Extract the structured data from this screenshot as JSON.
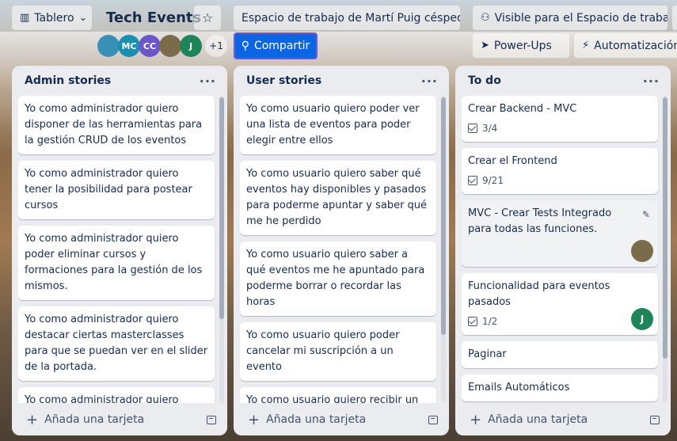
{
  "header": {
    "view_label": "Tablero",
    "board_title": "Tech Events",
    "workspace_label": "Espacio de trabajo de Martí Puig céspedes",
    "visibility_label": "Visible para el Espacio de trabajo",
    "share_label": "Compartir",
    "powerups_label": "Power-Ups",
    "automation_label": "Automatización",
    "extra_members": "+1",
    "members": [
      {
        "initials": "",
        "color": "#3a8fb7"
      },
      {
        "initials": "MC",
        "color": "#1a8fb0"
      },
      {
        "initials": "CC",
        "color": "#6b57c9"
      },
      {
        "initials": "",
        "color": "#7a6b4a"
      },
      {
        "initials": "J",
        "color": "#1f845a"
      }
    ]
  },
  "lists": [
    {
      "title": "Admin stories",
      "add_label": "Añada una tarjeta",
      "cards": [
        {
          "text": "Yo como administrador quiero disponer de las herramientas para la gestión CRUD de los eventos"
        },
        {
          "text": "Yo como administrador quiero tener la posibilidad para postear cursos"
        },
        {
          "text": "Yo como administrador quiero poder eliminar cursos y formaciones para la gestión de los mismos."
        },
        {
          "text": "Yo como administrador quiero destacar ciertas masterclasses para que se puedan ver en el slider de la portada."
        },
        {
          "text": "Yo como administrador quiero tener la posibilidad para la inscripción de alumnos a cursos y establecer un"
        }
      ]
    },
    {
      "title": "User stories",
      "add_label": "Añada una tarjeta",
      "cards": [
        {
          "text": "Yo como usuario quiero poder ver una lista de eventos para poder elegir entre ellos"
        },
        {
          "text": "Yo como usuario quiero saber qué eventos hay disponibles y pasados para poderme apuntar y saber qué me he perdido"
        },
        {
          "text": "Yo como usuario quiero saber a qué eventos me he apuntado para poderme borrar o recordar las horas"
        },
        {
          "text": "Yo como usuario quiero poder cancelar mi suscripción a un evento"
        },
        {
          "text": "Yo como usuario quiero recibir un email recordatorio del evento para que no se me pase la fecha"
        }
      ]
    },
    {
      "title": "To do",
      "add_label": "Añada una tarjeta",
      "cards": [
        {
          "text": "Crear Backend - MVC",
          "checklist": "3/4"
        },
        {
          "text": "Crear el Frontend",
          "checklist": "9/21"
        },
        {
          "text": "MVC - Crear Tests Integrado para todas las funciones.",
          "member": ""
        },
        {
          "text": "Funcionalidad para eventos pasados",
          "checklist": "1/2",
          "member": "J"
        },
        {
          "text": "Paginar"
        },
        {
          "text": "Emails Automáticos"
        }
      ]
    }
  ]
}
